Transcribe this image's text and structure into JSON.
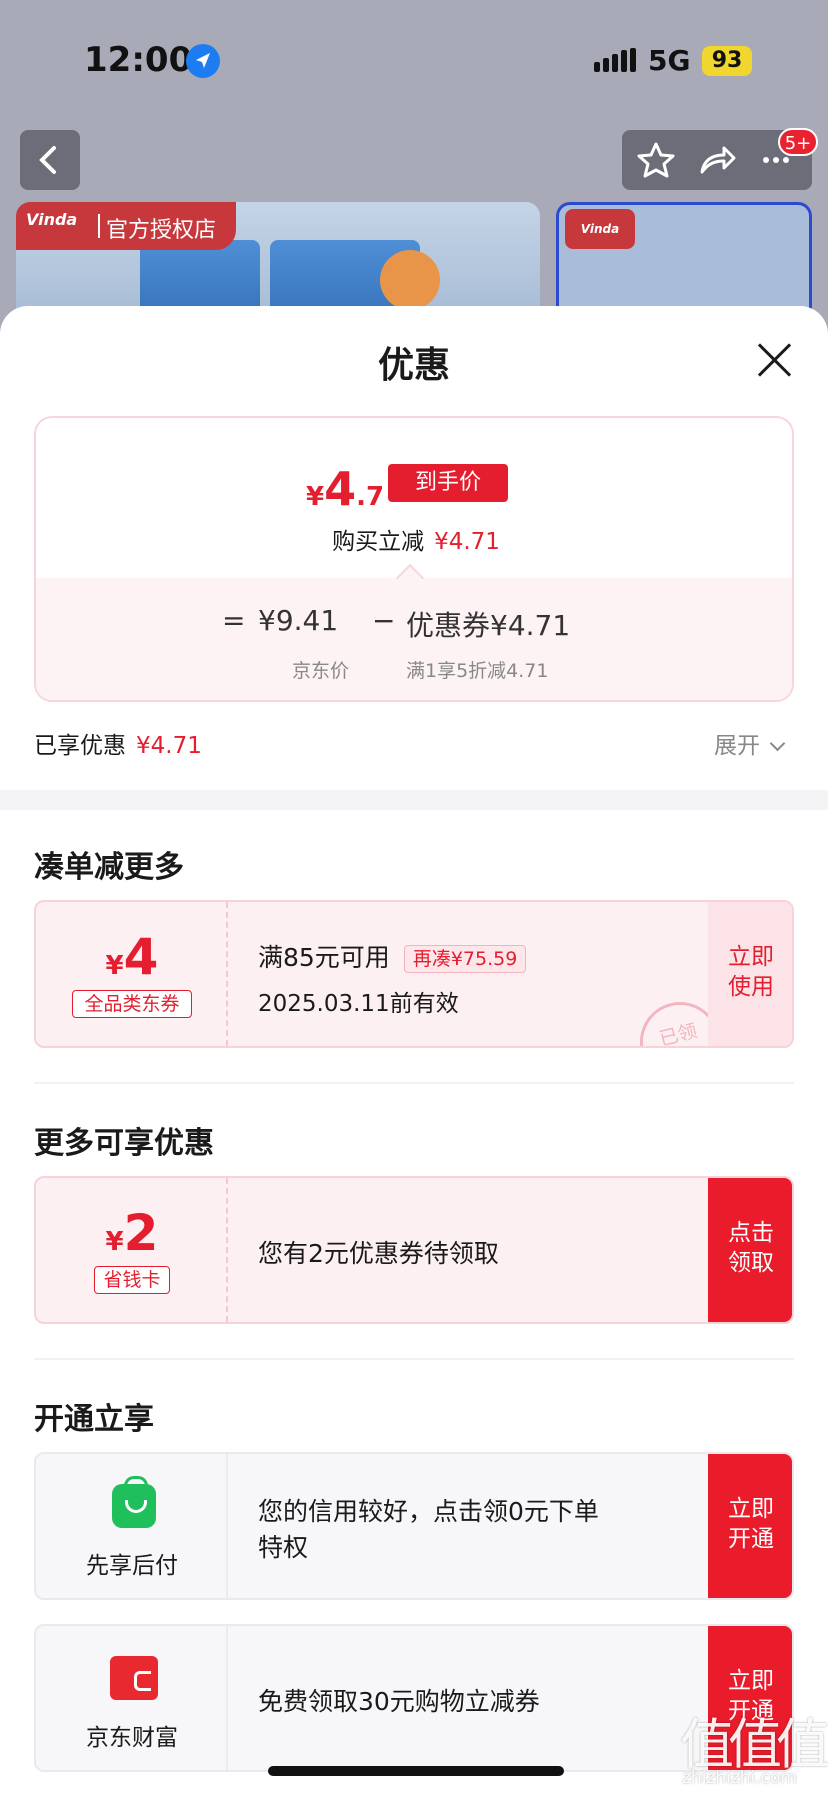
{
  "status_bar": {
    "time": "12:00",
    "network": "5G",
    "battery": "93"
  },
  "top_nav": {
    "notification_badge": "5+"
  },
  "product_images": {
    "brand_logo_text": "Vinda",
    "store_badge": "官方授权店"
  },
  "sheet": {
    "title": "优惠",
    "final_price": {
      "currency": "¥",
      "integer": "4",
      "decimal": ".7",
      "tag": "到手价"
    },
    "saving_line": {
      "label": "购买立减",
      "amount": "¥4.71"
    },
    "formula": {
      "equals": "=",
      "base_price": "¥9.41",
      "minus": "−",
      "coupon": "优惠券¥4.71",
      "base_label": "京东价",
      "coupon_label": "满1享5折减4.71"
    },
    "enjoyed": {
      "label": "已享优惠",
      "amount": "¥4.71"
    },
    "expand_label": "展开"
  },
  "section_combine": {
    "title": "凑单减更多",
    "coupon": {
      "currency": "¥",
      "value": "4",
      "tag": "全品类东券",
      "condition": "满85元可用",
      "need_more": "再凑¥75.59",
      "valid_until": "2025.03.11前有效",
      "button": "立即使用",
      "stamp": "已领"
    }
  },
  "section_more": {
    "title": "更多可享优惠",
    "coupon": {
      "currency": "¥",
      "value": "2",
      "tag": "省钱卡",
      "description": "您有2元优惠券待领取",
      "button": "点击领取"
    }
  },
  "section_open": {
    "title": "开通立享",
    "items": [
      {
        "icon": "shopping-bag-icon",
        "name": "先享后付",
        "desc_line1": "您的信用较好，点击领0元下单",
        "desc_line2": "特权",
        "button": "立即开通"
      },
      {
        "icon": "wallet-icon",
        "name": "京东财富",
        "desc_line1": "免费领取30元购物立减券",
        "button": "立即开通"
      }
    ]
  },
  "watermark": {
    "main": "值值值",
    "sub": "zhizhizhi.com"
  },
  "colors": {
    "accent_red": "#e41e2f",
    "button_red": "#ea1b2b",
    "coupon_bg": "#fdf0f2"
  }
}
